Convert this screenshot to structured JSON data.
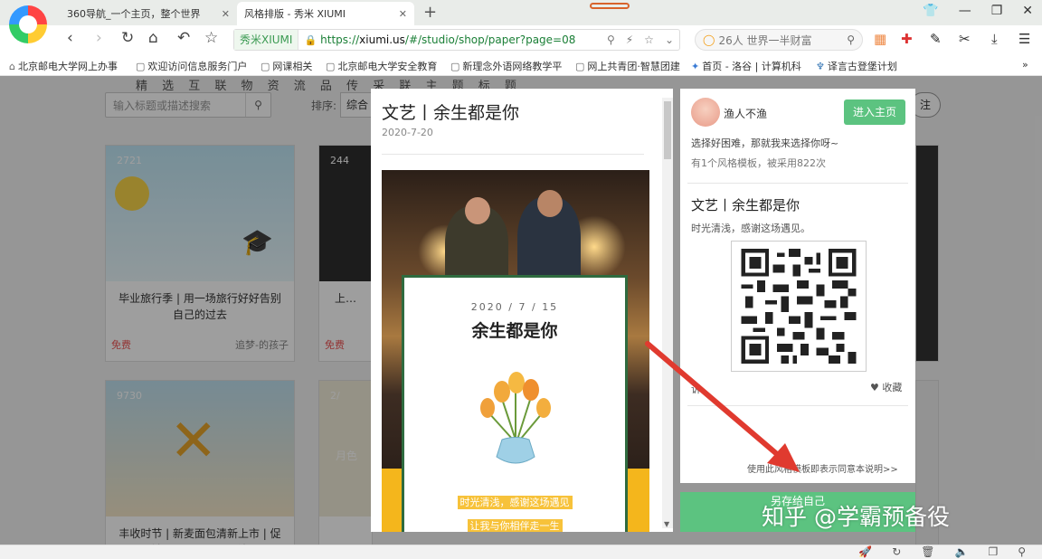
{
  "browser": {
    "tabs": [
      {
        "title": "360导航_一个主页，整个世界",
        "icon": "360-nav-icon"
      },
      {
        "title": "风格排版 - 秀米 XIUMI",
        "icon": "xiumi-icon"
      }
    ],
    "address": {
      "site_badge": "秀米XIUMI",
      "url_scheme": "https://",
      "url_host": "xiumi.us",
      "url_path": "/#/studio/shop/paper?page=08"
    },
    "search": {
      "placeholder": "26人 世界一半财富"
    },
    "bookmarks": [
      "北京邮电大学网上办事",
      "欢迎访问信息服务门户",
      "网课相关",
      "北京邮电大学安全教育",
      "新理念外语网络教学平",
      "网上共青团·智慧团建",
      "首页 - 洛谷 | 计算机科",
      "译言古登堡计划"
    ]
  },
  "gallery": {
    "filters": "精 选 互 联 物 资 流 品 传 采 联 主 题 标 题",
    "search_placeholder": "输入标题或描述搜索",
    "sort_label": "排序:",
    "sort_value": "综合",
    "follow": "注",
    "cards": [
      {
        "views": "2721",
        "title": "毕业旅行季 | 用一场旅行好好告别自己的过去",
        "price": "免费",
        "author": "追梦-的孩子"
      },
      {
        "views": "244",
        "title": "上…",
        "price": "免费",
        "author": ""
      },
      {
        "views": "9730",
        "title": "丰收时节 | 新麦面包清新上市 | 促销通用 | 夏天 | 小清",
        "price": "",
        "author": ""
      },
      {
        "views": "2/",
        "title": "月色",
        "price": "",
        "author": ""
      }
    ]
  },
  "preview": {
    "title": "文艺丨余生都是你",
    "date": "2020-7-20",
    "inner_date": "2020 / 7 / 15",
    "inner_title": "余生都是你",
    "line1": "时光清浅，感谢这场遇见",
    "line2": "让我与你相伴走一生"
  },
  "side": {
    "author": "渔人不渔",
    "enter_button": "进入主页",
    "slogan": "选择好困难，那就我来选择你呀~",
    "template_count": "有1个风格模板，被采用822次",
    "template_title": "文艺丨余生都是你",
    "template_desc": "时光清浅，感谢这场遇见。",
    "left_label": "诉",
    "favorite": "收藏",
    "agree": "使用此风格模板即表示同意本说明>>",
    "save_button": "另存给自己"
  },
  "watermark": "知乎 @学霸预备役",
  "colors": {
    "accent_green": "#5cc380",
    "arrow_red": "#e03a2f",
    "frame_green": "#2f6b3f",
    "highlight_yellow": "#f7c23a"
  }
}
